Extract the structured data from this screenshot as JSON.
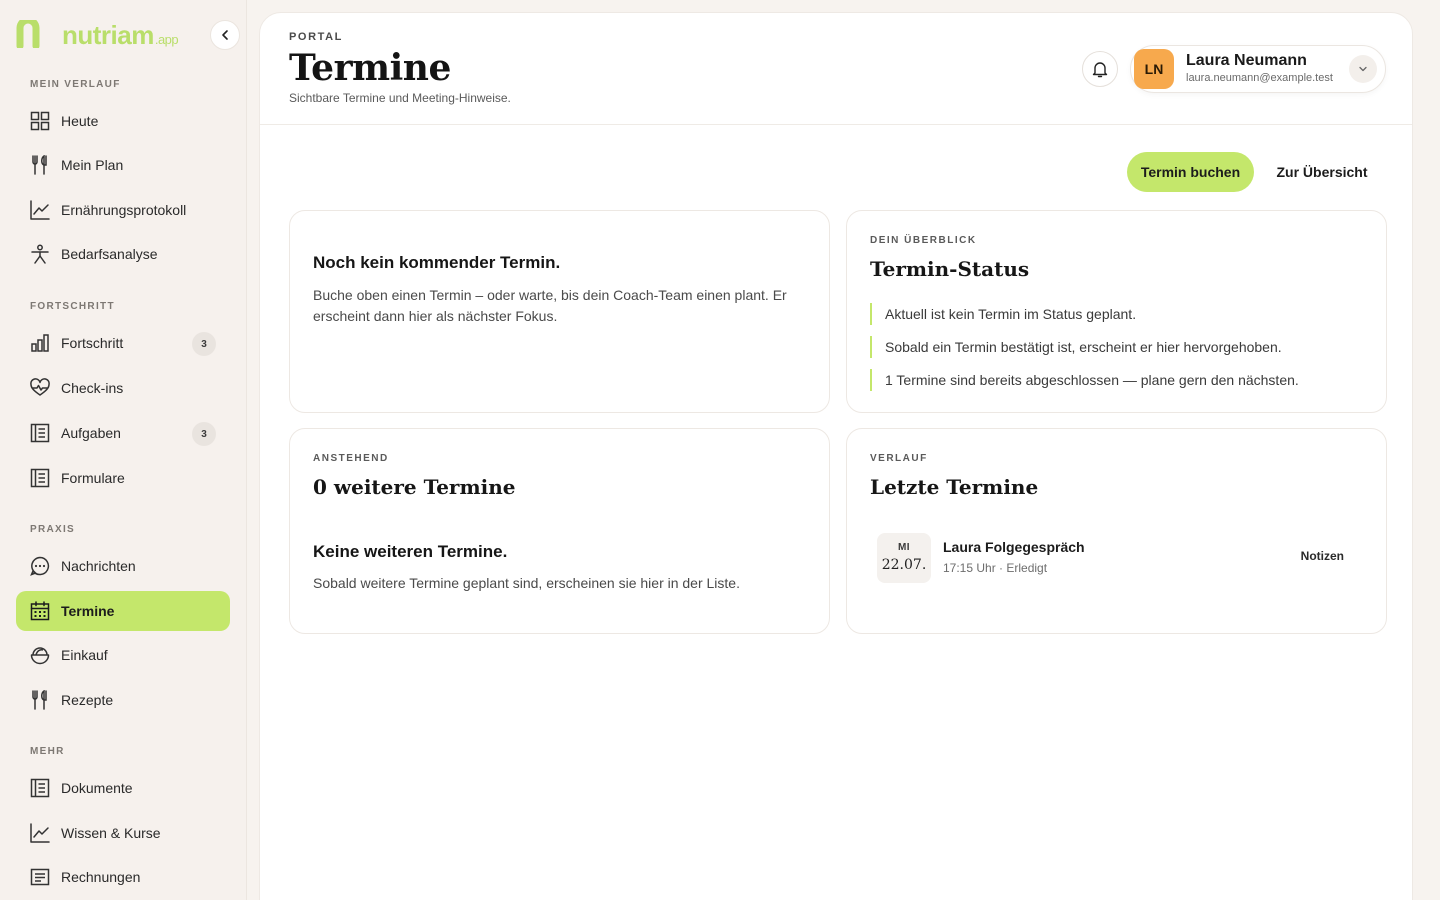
{
  "brand": {
    "name": "nutriam",
    "suffix": ".app",
    "color": "#b9de6a"
  },
  "sidebar": {
    "sections": [
      {
        "label": "MEIN VERLAUF",
        "items": [
          {
            "label": "Heute",
            "icon": "grid-icon"
          },
          {
            "label": "Mein Plan",
            "icon": "utensils-icon"
          },
          {
            "label": "Ernährungsprotokoll",
            "icon": "chart-line-icon"
          },
          {
            "label": "Bedarfsanalyse",
            "icon": "person-icon"
          }
        ]
      },
      {
        "label": "FORTSCHRITT",
        "items": [
          {
            "label": "Fortschritt",
            "icon": "bar-chart-icon",
            "badge": "3"
          },
          {
            "label": "Check-ins",
            "icon": "heart-pulse-icon"
          },
          {
            "label": "Aufgaben",
            "icon": "list-icon",
            "badge": "3"
          },
          {
            "label": "Formulare",
            "icon": "list-icon"
          }
        ]
      },
      {
        "label": "PRAXIS",
        "items": [
          {
            "label": "Nachrichten",
            "icon": "chat-icon"
          },
          {
            "label": "Termine",
            "icon": "calendar-icon",
            "active": true
          },
          {
            "label": "Einkauf",
            "icon": "basket-icon"
          },
          {
            "label": "Rezepte",
            "icon": "utensils-icon"
          }
        ]
      },
      {
        "label": "MEHR",
        "items": [
          {
            "label": "Dokumente",
            "icon": "list-icon"
          },
          {
            "label": "Wissen & Kurse",
            "icon": "chart-line-icon"
          },
          {
            "label": "Rechnungen",
            "icon": "receipt-icon"
          }
        ]
      }
    ]
  },
  "header": {
    "eyebrow": "PORTAL",
    "title": "Termine",
    "subtitle": "Sichtbare Termine und Meeting-Hinweise."
  },
  "user": {
    "initials": "LN",
    "name": "Laura Neumann",
    "email": "laura.neumann@example.test",
    "avatar_color": "#f7a94d"
  },
  "actions": {
    "book_label": "Termin buchen",
    "overview_label": "Zur Übersicht"
  },
  "cards": {
    "next": {
      "title": "Noch kein kommender Termin.",
      "body": "Buche oben einen Termin – oder warte, bis dein Coach-Team einen plant. Er erscheint dann hier als nächster Fokus."
    },
    "status": {
      "eyebrow": "DEIN ÜBERBLICK",
      "title": "Termin-Status",
      "lines": [
        "Aktuell ist kein Termin im Status geplant.",
        "Sobald ein Termin bestätigt ist, erscheint er hier hervorgehoben.",
        "1 Termine sind bereits abgeschlossen — plane gern den nächsten."
      ]
    },
    "upcoming": {
      "eyebrow": "ANSTEHEND",
      "title": "0 weitere Termine",
      "empty_title": "Keine weiteren Termine.",
      "empty_body": "Sobald weitere Termine geplant sind, erscheinen sie hier in der Liste."
    },
    "history": {
      "eyebrow": "VERLAUF",
      "title": "Letzte Termine",
      "items": [
        {
          "dow": "MI",
          "date": "22.07.",
          "title": "Laura Folgegespräch",
          "meta": "17:15 Uhr · Erledigt",
          "action": "Notizen"
        }
      ]
    }
  },
  "colors": {
    "accent": "#c4e76b",
    "sidebar_bg": "#f6f1ed"
  }
}
